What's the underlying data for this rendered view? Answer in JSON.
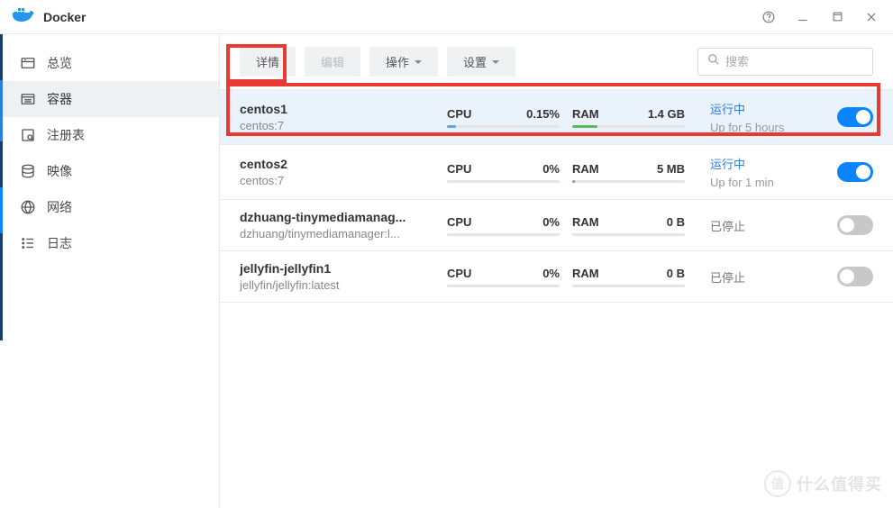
{
  "titlebar": {
    "title": "Docker"
  },
  "sidebar": {
    "items": [
      {
        "label": "总览"
      },
      {
        "label": "容器"
      },
      {
        "label": "注册表"
      },
      {
        "label": "映像"
      },
      {
        "label": "网络"
      },
      {
        "label": "日志"
      }
    ]
  },
  "toolbar": {
    "details": "详情",
    "edit": "编辑",
    "action": "操作",
    "settings": "设置",
    "search_placeholder": "搜索"
  },
  "labels": {
    "cpu": "CPU",
    "ram": "RAM"
  },
  "status": {
    "running": "运行中",
    "stopped": "已停止"
  },
  "containers": [
    {
      "name": "centos1",
      "image": "centos:7",
      "cpu": "0.15%",
      "cpu_pct": 8,
      "ram": "1.4 GB",
      "ram_pct": 22,
      "running": true,
      "uptime": "Up for 5 hours",
      "selected": true
    },
    {
      "name": "centos2",
      "image": "centos:7",
      "cpu": "0%",
      "cpu_pct": 0,
      "ram": "5 MB",
      "ram_pct": 2,
      "running": true,
      "uptime": "Up for 1 min",
      "selected": false
    },
    {
      "name": "dzhuang-tinymediamanag...",
      "image": "dzhuang/tinymediamanager:l...",
      "cpu": "0%",
      "cpu_pct": 0,
      "ram": "0 B",
      "ram_pct": 0,
      "running": false,
      "uptime": "",
      "selected": false
    },
    {
      "name": "jellyfin-jellyfin1",
      "image": "jellyfin/jellyfin:latest",
      "cpu": "0%",
      "cpu_pct": 0,
      "ram": "0 B",
      "ram_pct": 0,
      "running": false,
      "uptime": "",
      "selected": false
    }
  ],
  "watermark": "什么值得买"
}
